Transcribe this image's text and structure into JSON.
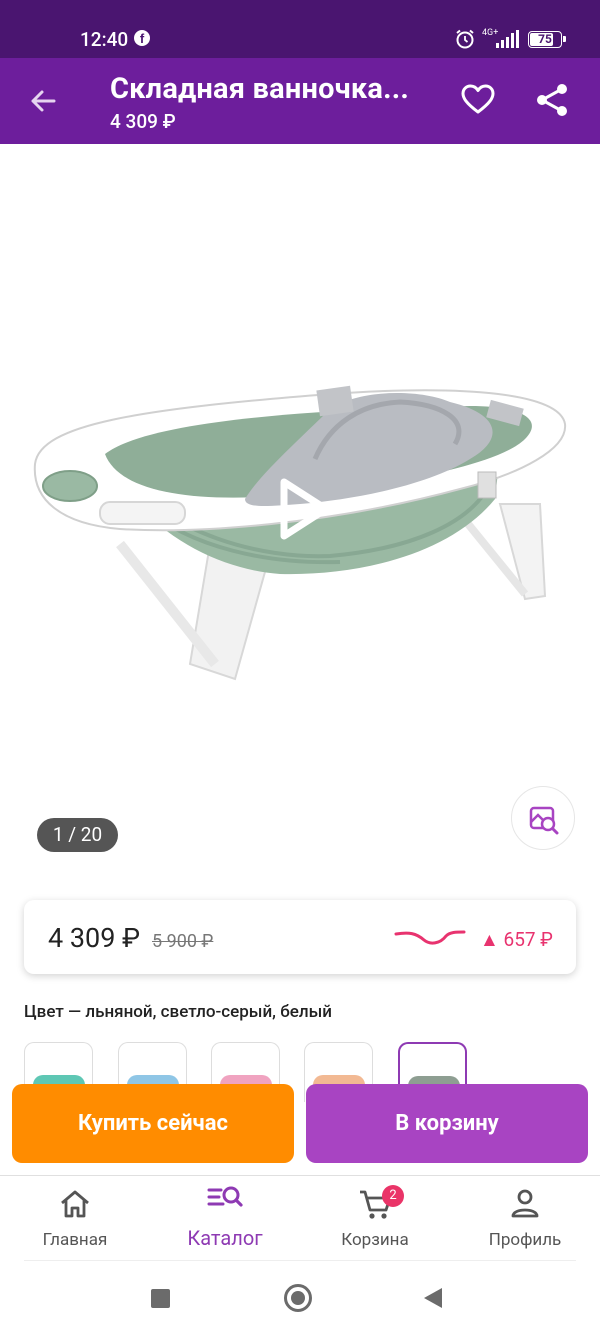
{
  "status_bar": {
    "time": "12:40",
    "facebook_icon": "f",
    "network": "4G+",
    "battery": "75"
  },
  "header": {
    "title": "Складная ванночка...",
    "price": "4 309 ₽"
  },
  "gallery": {
    "counter": "1 / 20"
  },
  "price_card": {
    "price": "4 309 ₽",
    "old_price": "5 900 ₽",
    "delta": "▲ 657 ₽",
    "accent_color": "#e8336f"
  },
  "color_label": "Цвет — льняной, светло-серый, белый",
  "swatches": [
    {
      "name": "teal",
      "color": "#5ec7b4"
    },
    {
      "name": "blue",
      "color": "#8fc6e6"
    },
    {
      "name": "pink",
      "color": "#f0a3c0"
    },
    {
      "name": "peach",
      "color": "#f2b993"
    },
    {
      "name": "gray",
      "color": "#8e9e92",
      "selected": true
    }
  ],
  "actions": {
    "buy_now": "Купить сейчас",
    "add_to_cart": "В корзину"
  },
  "bottom_nav": {
    "home": "Главная",
    "catalog": "Каталог",
    "cart": "Корзина",
    "cart_badge": "2",
    "profile": "Профиль"
  },
  "colors": {
    "status_bar": "#4a1570",
    "app_bar": "#6d1e9c",
    "buy_button": "#ff8c00",
    "cart_button": "#a844c2",
    "active_nav": "#8e3ab3"
  }
}
